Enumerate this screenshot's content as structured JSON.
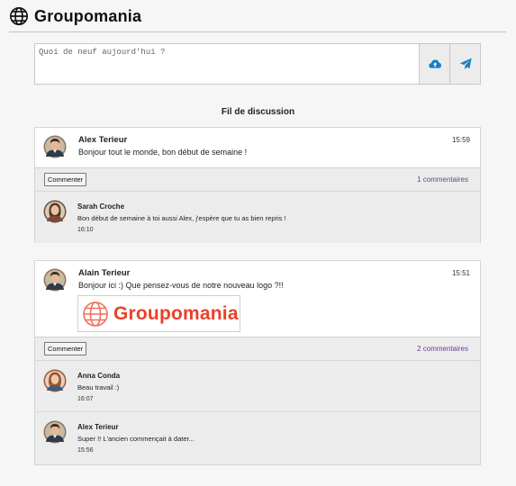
{
  "app": {
    "title": "Groupomania"
  },
  "composer": {
    "placeholder": "Quoi de neuf aujourd'hui ?",
    "upload_icon": "cloud-upload-icon",
    "send_icon": "paper-plane-icon"
  },
  "feed": {
    "title": "Fil de discussion"
  },
  "posts": [
    {
      "author": "Alex Terieur",
      "time": "15:59",
      "text": "Bonjour tout le monde, bon début de semaine !",
      "comment_button": "Commenter",
      "comment_count": "1 commentaires",
      "comments": [
        {
          "author": "Sarah Croche",
          "text": "Bon début de semaine à toi aussi Alex, j'espère que tu as bien repris !",
          "time": "16:10"
        }
      ]
    },
    {
      "author": "Alain Terieur",
      "time": "15:51",
      "text": "Bonjour ici :) Que pensez-vous de notre nouveau logo ?!!",
      "image_text": "Groupomania",
      "comment_button": "Commenter",
      "comment_count": "2 commentaires",
      "comments": [
        {
          "author": "Anna Conda",
          "text": "Beau travail :)",
          "time": "16:07"
        },
        {
          "author": "Alex Terieur",
          "text": "Super !! L'ancien commençait à dater...",
          "time": "15:56"
        }
      ]
    }
  ],
  "colors": {
    "brand_red": "#e8412a",
    "accent_blue": "#1a7fc1",
    "link_purple": "#6a3f8f"
  }
}
